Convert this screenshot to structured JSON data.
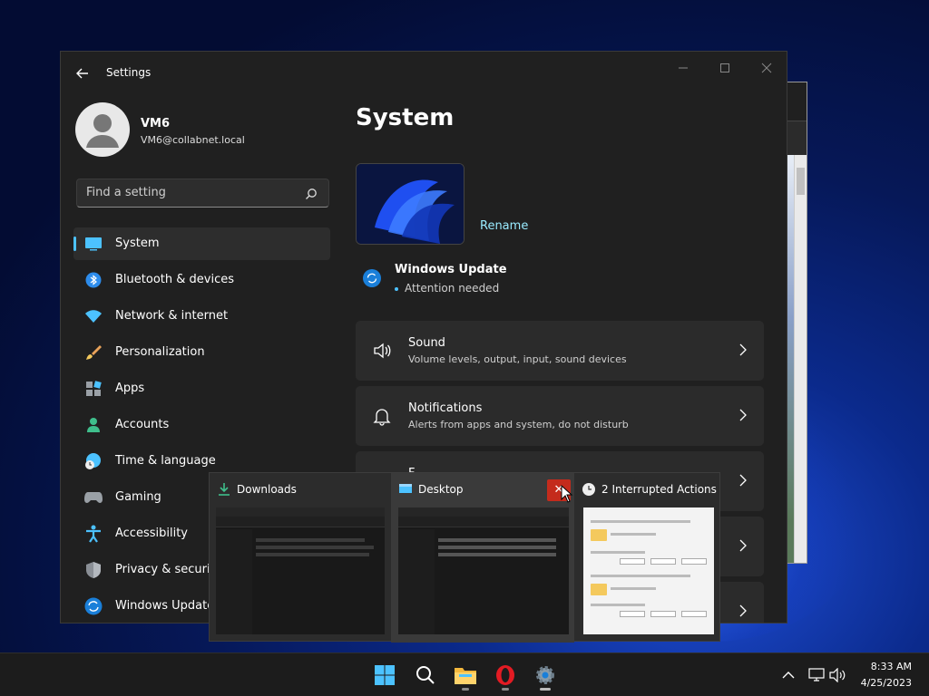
{
  "window": {
    "title": "Settings"
  },
  "profile": {
    "name": "VM6",
    "email": "VM6@collabnet.local"
  },
  "search": {
    "placeholder": "Find a setting"
  },
  "nav": {
    "items": [
      {
        "label": "System",
        "icon": "display-icon"
      },
      {
        "label": "Bluetooth & devices",
        "icon": "bluetooth-icon"
      },
      {
        "label": "Network & internet",
        "icon": "wifi-icon"
      },
      {
        "label": "Personalization",
        "icon": "brush-icon"
      },
      {
        "label": "Apps",
        "icon": "apps-icon"
      },
      {
        "label": "Accounts",
        "icon": "person-icon"
      },
      {
        "label": "Time & language",
        "icon": "globe-clock-icon"
      },
      {
        "label": "Gaming",
        "icon": "gamepad-icon"
      },
      {
        "label": "Accessibility",
        "icon": "accessibility-icon"
      },
      {
        "label": "Privacy & security",
        "icon": "shield-icon"
      },
      {
        "label": "Windows Update",
        "icon": "update-icon"
      }
    ]
  },
  "main": {
    "title": "System",
    "rename": "Rename",
    "update": {
      "title": "Windows Update",
      "status": "Attention needed"
    },
    "cards": [
      {
        "title": "Sound",
        "subtitle": "Volume levels, output, input, sound devices",
        "icon": "speaker-icon"
      },
      {
        "title": "Notifications",
        "subtitle": "Alerts from apps and system, do not disturb",
        "icon": "bell-icon"
      },
      {
        "title": "F",
        "subtitle": "",
        "icon": ""
      },
      {
        "title": "",
        "subtitle": "",
        "icon": ""
      },
      {
        "title": "",
        "subtitle": "",
        "icon": ""
      }
    ]
  },
  "task_preview": {
    "thumbs": [
      {
        "title": "Downloads",
        "icon": "download-icon"
      },
      {
        "title": "Desktop",
        "icon": "desktop-icon",
        "close": "✕"
      },
      {
        "title": "2 Interrupted Actions",
        "icon": "clock-icon"
      }
    ]
  },
  "taskbar": {
    "time": "8:33 AM",
    "date": "4/25/2023"
  },
  "colors": {
    "accent": "#4cc2ff",
    "close_red": "#c42b1c",
    "link": "#99ebff"
  }
}
